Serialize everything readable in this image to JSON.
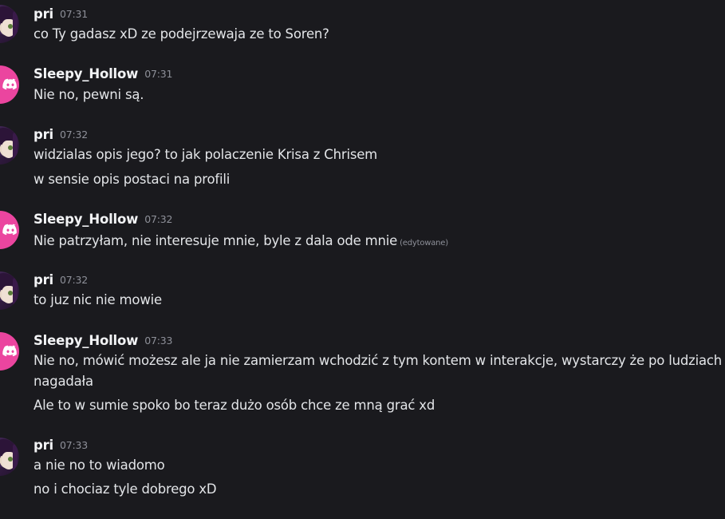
{
  "messages": [
    {
      "author": "pri",
      "time": "07:31",
      "avatar": "pri-avatar",
      "lines": [
        "co Ty gadasz xD ze podejrzewaja ze to Soren?"
      ]
    },
    {
      "author": "Sleepy_Hollow",
      "time": "07:31",
      "avatar": "discord-avatar",
      "lines": [
        "Nie no, pewni są."
      ]
    },
    {
      "author": "pri",
      "time": "07:32",
      "avatar": "pri-avatar",
      "lines": [
        "widzialas opis jego? to jak polaczenie Krisa z Chrisem",
        "w sensie opis postaci na profili"
      ]
    },
    {
      "author": "Sleepy_Hollow",
      "time": "07:32",
      "avatar": "discord-avatar",
      "lines": [
        "Nie patrzyłam, nie interesuje mnie, byle z dala ode mnie"
      ],
      "edited": "(edytowane)"
    },
    {
      "author": "pri",
      "time": "07:32",
      "avatar": "pri-avatar",
      "lines": [
        "to juz nic nie mowie"
      ]
    },
    {
      "author": "Sleepy_Hollow",
      "time": "07:33",
      "avatar": "discord-avatar",
      "lines": [
        "Nie no, mówić możesz ale ja nie zamierzam wchodzić z tym kontem w interakcje, wystarczy że po ludziach",
        "nagadała",
        "Ale to w sumie spoko bo teraz dużo osób chce ze mną grać xd"
      ]
    },
    {
      "author": "pri",
      "time": "07:33",
      "avatar": "pri-avatar",
      "lines": [
        "a nie no to wiadomo",
        "no i chociaz tyle dobrego xD"
      ]
    }
  ],
  "colors": {
    "background": "#1a1a1e",
    "username": "#f2f3f5",
    "message_text": "#e3e5e8",
    "timestamp": "#8e9099",
    "discord_avatar": "#eb459f"
  }
}
